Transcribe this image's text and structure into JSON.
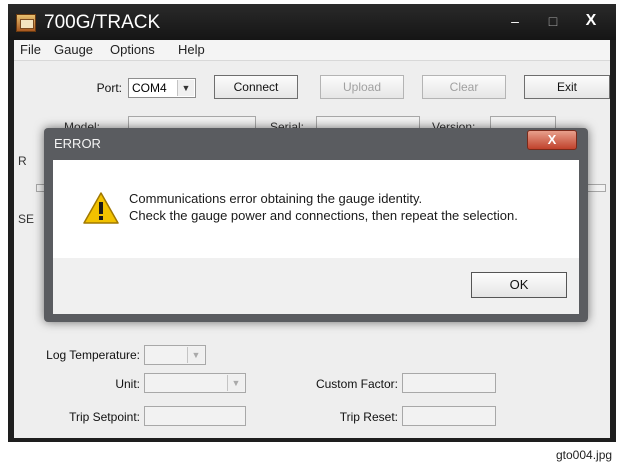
{
  "window": {
    "title": "700G/TRACK",
    "minimize": "‒",
    "maximize": "□",
    "close": "X"
  },
  "menu": [
    "File",
    "Gauge",
    "Options",
    "Help"
  ],
  "port": {
    "label": "Port:",
    "value": "COM4"
  },
  "buttons": {
    "connect": "Connect",
    "upload": "Upload",
    "clear": "Clear",
    "exit": "Exit"
  },
  "info": {
    "model": "Model:",
    "serial": "Serial:",
    "version": "Version:"
  },
  "partial_labels": {
    "r": "R",
    "se": "SE"
  },
  "log_temperature": {
    "label": "Log Temperature:",
    "value": ""
  },
  "unit": {
    "label": "Unit:",
    "value": ""
  },
  "custom_factor": {
    "label": "Custom Factor:",
    "value": ""
  },
  "trip_setpoint": {
    "label": "Trip Setpoint:",
    "value": ""
  },
  "trip_reset": {
    "label": "Trip Reset:",
    "value": ""
  },
  "dialog": {
    "title": "ERROR",
    "close": "X",
    "message_line1": "Communications error obtaining the gauge identity.",
    "message_line2": "Check the gauge power and connections, then repeat the selection.",
    "ok": "OK"
  },
  "caption": "gto004.jpg",
  "colors": {
    "titlebar": "#1e1e1e",
    "dialog_frame": "#5a5c60",
    "close_button": "#c0422c",
    "warning": "#f2c200"
  }
}
